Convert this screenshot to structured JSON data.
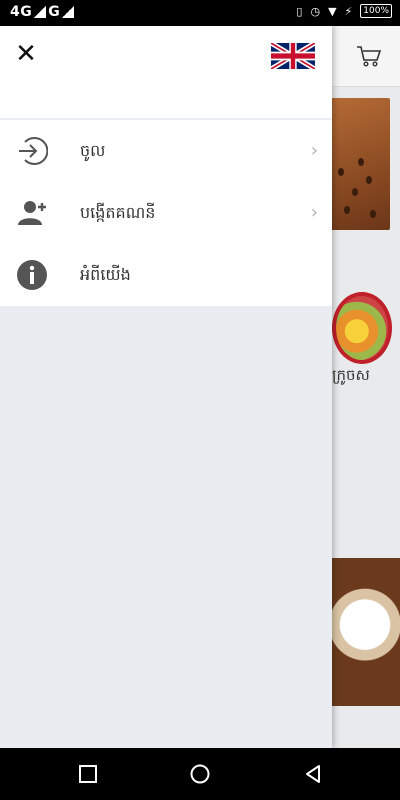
{
  "status_bar": {
    "network1": "4G",
    "network2": "G",
    "battery": "100%"
  },
  "drawer": {
    "menu": [
      {
        "label": "ចូល",
        "icon": "login-arrow-icon",
        "has_chevron": true
      },
      {
        "label": "បង្កើតគណនី",
        "icon": "add-user-icon",
        "has_chevron": true
      },
      {
        "label": "អំពីយើង",
        "icon": "info-icon",
        "has_chevron": false
      }
    ]
  },
  "background": {
    "juice_label": "ក្រូចស"
  },
  "colors": {
    "drawer_bg": "#e9ecf0",
    "icon_gray": "#555555",
    "flag_blue": "#012169",
    "flag_red": "#C8102E"
  }
}
